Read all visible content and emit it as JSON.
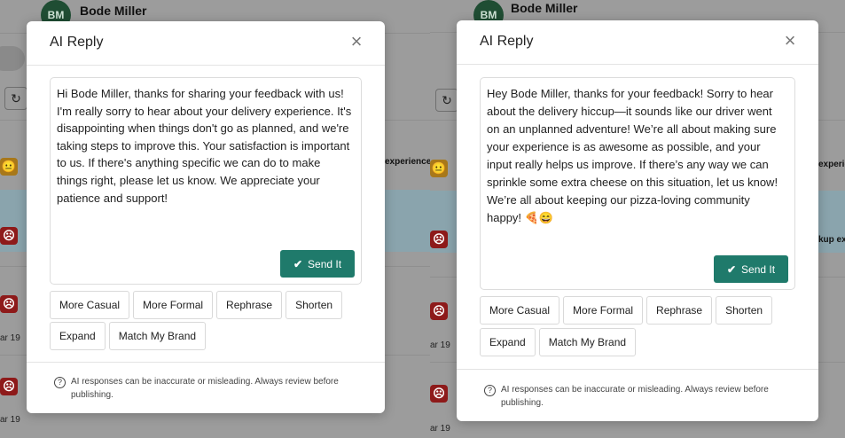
{
  "background": {
    "avatar_initials": "BM",
    "contact_name": "Bode Miller",
    "snippet_1": "experience?",
    "snippet_2": "kup experi",
    "date_label": "ar 19"
  },
  "dialogs": [
    {
      "title": "AI Reply",
      "reply": "Hi Bode Miller, thanks for sharing your feedback with us! I'm really sorry to hear about your delivery experience. It's disappointing when things don't go as planned, and we're taking steps to improve this. Your satisfaction is important to us. If there's anything specific we can do to make things right, please let us know. We appreciate your patience and support!",
      "send_label": "Send It",
      "options": [
        "More Casual",
        "More Formal",
        "Rephrase",
        "Shorten",
        "Expand",
        "Match My Brand"
      ],
      "disclaimer": "AI responses can be inaccurate or misleading. Always review before publishing."
    },
    {
      "title": "AI Reply",
      "reply": "Hey Bode Miller, thanks for your feedback! Sorry to hear about the delivery hiccup—it sounds like our driver went on an unplanned adventure! We’re all about making sure your experience is as awesome as possible, and your input really helps us improve. If there’s any way we can sprinkle some extra cheese on this situation, let us know! We’re all about keeping our pizza-loving community happy! 🍕😄",
      "send_label": "Send It",
      "options": [
        "More Casual",
        "More Formal",
        "Rephrase",
        "Shorten",
        "Expand",
        "Match My Brand"
      ],
      "disclaimer": "AI responses can be inaccurate or misleading. Always review before publishing."
    }
  ],
  "icons": {
    "close": "close-icon",
    "send": "check-icon",
    "info": "info-icon",
    "refresh": "refresh-icon",
    "sad": "sad-face-icon",
    "neutral": "neutral-face-icon"
  },
  "colors": {
    "send_button": "#1f7a6b",
    "overlay": "#9c9c9c",
    "sad_badge": "#8e1a1a",
    "neutral_badge": "#a8781a"
  }
}
